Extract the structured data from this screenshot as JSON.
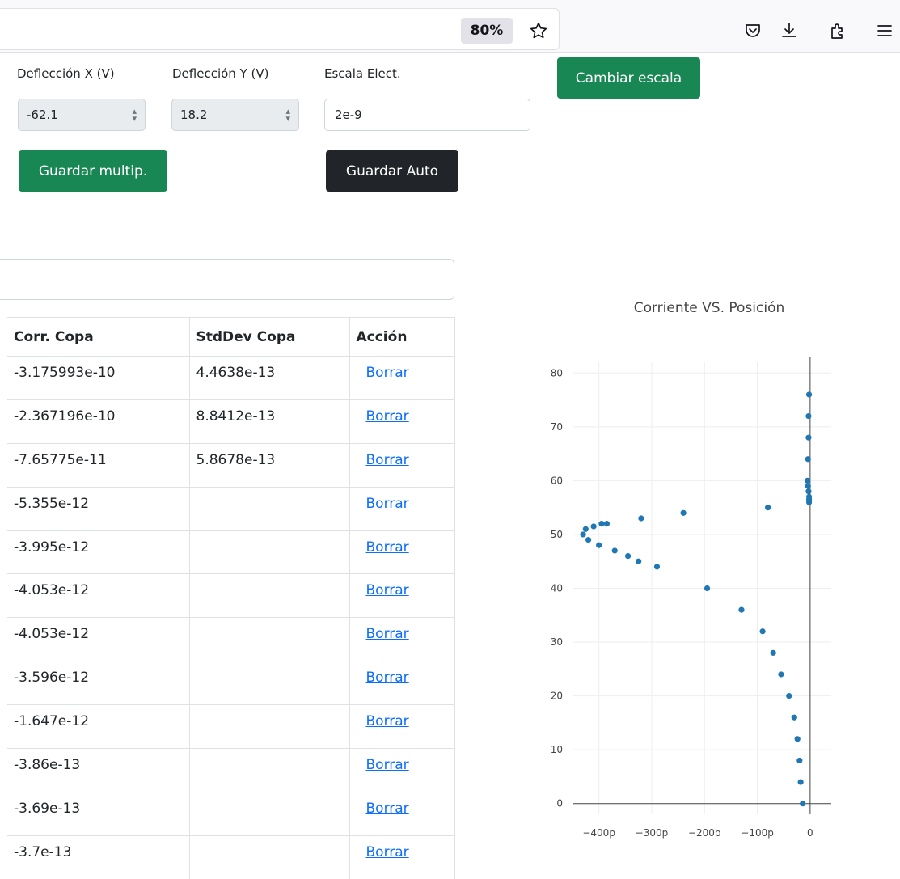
{
  "browser": {
    "zoom": "80%",
    "icons": [
      "bookmark-star-icon",
      "pocket-icon",
      "download-icon",
      "extensions-icon",
      "menu-icon"
    ]
  },
  "form": {
    "deflx_label": "Deflección X (V)",
    "defly_label": "Deflección Y (V)",
    "scale_label": "Escala Elect.",
    "deflx_value": "-62.1",
    "defly_value": "18.2",
    "scale_value": "2e-9",
    "change_scale_button": "Cambiar escala",
    "save_multi_button": "Guardar multip.",
    "save_auto_button": "Guardar Auto"
  },
  "table": {
    "headers": [
      "Corr. Copa",
      "StdDev Copa",
      "Acción"
    ],
    "action_label": "Borrar",
    "rows": [
      {
        "corr": "-3.175993e-10",
        "std": "4.4638e-13"
      },
      {
        "corr": "-2.367196e-10",
        "std": "8.8412e-13"
      },
      {
        "corr": "-7.65775e-11",
        "std": "5.8678e-13"
      },
      {
        "corr": "-5.355e-12",
        "std": ""
      },
      {
        "corr": "-3.995e-12",
        "std": ""
      },
      {
        "corr": "-4.053e-12",
        "std": ""
      },
      {
        "corr": "-4.053e-12",
        "std": ""
      },
      {
        "corr": "-3.596e-12",
        "std": ""
      },
      {
        "corr": "-1.647e-12",
        "std": ""
      },
      {
        "corr": "-3.86e-13",
        "std": ""
      },
      {
        "corr": "-3.69e-13",
        "std": ""
      },
      {
        "corr": "-3.7e-13",
        "std": ""
      }
    ]
  },
  "chart_data": {
    "type": "scatter",
    "title": "Corriente VS. Posición",
    "xlim": [
      -450,
      40
    ],
    "ylim": [
      -2,
      82
    ],
    "x_ticks": [
      -400,
      -300,
      -200,
      -100,
      0
    ],
    "x_tick_labels": [
      "−400p",
      "−300p",
      "−200p",
      "−100p",
      "0"
    ],
    "y_ticks": [
      0,
      10,
      20,
      30,
      40,
      50,
      60,
      70,
      80
    ],
    "y_tick_labels": [
      "0",
      "10",
      "20",
      "30",
      "40",
      "50",
      "60",
      "70",
      "80"
    ],
    "grid": true,
    "color": "#1f77b4",
    "x": [
      -14,
      -18,
      -20,
      -24,
      -30,
      -40,
      -55,
      -70,
      -90,
      -130,
      -195,
      -290,
      -325,
      -345,
      -370,
      -400,
      -385,
      -430,
      -425,
      -420,
      -410,
      -395,
      -320,
      -240,
      -80,
      -2,
      -3,
      -3,
      -4,
      -5,
      -4,
      -3,
      -2,
      -2,
      -2
    ],
    "y": [
      0,
      4,
      8,
      12,
      16,
      20,
      24,
      28,
      32,
      36,
      40,
      44,
      45,
      46,
      47,
      48,
      52,
      50,
      51,
      49,
      51.5,
      52,
      53,
      54,
      55,
      76,
      72,
      68,
      64,
      60,
      59,
      58,
      57,
      56.5,
      56
    ]
  }
}
